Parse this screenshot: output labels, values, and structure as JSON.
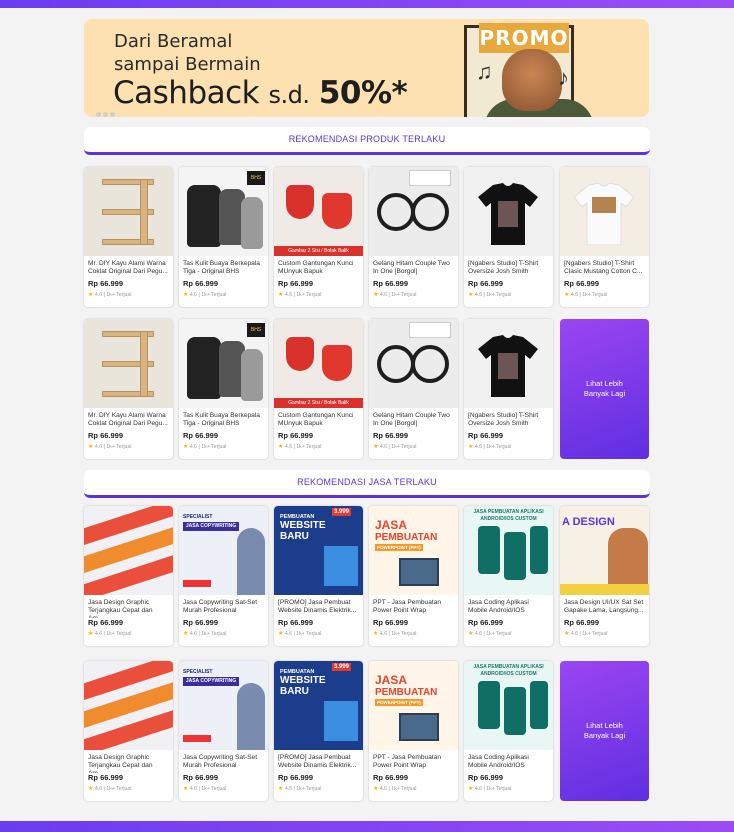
{
  "banner": {
    "line1": "Dari Beramal",
    "line2": "sampai Bermain",
    "cashback": "Cashback",
    "sd": "s.d.",
    "percent": "50%*",
    "promo": "PROMO"
  },
  "sections": {
    "products_title": "REKOMENDASI PRODUK TERLAKU",
    "services_title": "REKOMENDASI JASA TERLAKU"
  },
  "more_label": "Lihat Lebih Banyak Lagi",
  "product_row1": [
    {
      "name": "Mr. DIY Kayu Alami Warna Coklat Original Dari Pegu...",
      "price": "Rp 66.999",
      "rating": "4.6 | 1k+ Terjual"
    },
    {
      "name": "Tas Kulit Buaya Berkepala Tiga - Original BHS",
      "price": "Rp 66.999",
      "rating": "4.6 | 1k+ Terjual"
    },
    {
      "name": "Custom Gantungan Kunci MUnyuk Bapuk",
      "price": "Rp 66.999",
      "rating": "4.6 | 1k+ Terjual"
    },
    {
      "name": "Gelang Hitam Couple Two In One [Borgol]",
      "price": "Rp 66.999",
      "rating": "4.6 | 1k+ Terjual"
    },
    {
      "name": "[Ngabers Studio] T-Shirt Oversize Josh Smith",
      "price": "Rp 66.999",
      "rating": "4.6 | 1k+ Terjual"
    },
    {
      "name": "[Ngabers Studio] T-Shirt Clasic Mustang Cotton C...",
      "price": "Rp 66.999",
      "rating": "4.6 | 1k+ Terjual"
    }
  ],
  "product_row2": [
    {
      "name": "Mr. DIY Kayu Alami Warna Coklat Original Dari Pegu...",
      "price": "Rp 66.999",
      "rating": "4.6 | 1k+ Terjual"
    },
    {
      "name": "Tas Kulit Buaya Berkepala Tiga - Original BHS",
      "price": "Rp 66.999",
      "rating": "4.6 | 1k+ Terjual"
    },
    {
      "name": "Custom Gantungan Kunci MUnyuk Bapuk",
      "price": "Rp 66.999",
      "rating": "4.6 | 1k+ Terjual"
    },
    {
      "name": "Gelang Hitam Couple Two In One [Borgol]",
      "price": "Rp 66.999",
      "rating": "4.6 | 1k+ Terjual"
    },
    {
      "name": "[Ngabers Studio] T-Shirt Oversize Josh Smith",
      "price": "Rp 66.999",
      "rating": "4.6 | 1k+ Terjual"
    }
  ],
  "service_row1": [
    {
      "name": "Jasa Design Graphic Terjangkau Cepat dan Am...",
      "price": "Rp 66.999",
      "rating": "4.6 | 1k+ Terjual"
    },
    {
      "name": "Jasa Copywriting Sat-Set Murah Profesional",
      "price": "Rp 66.999",
      "rating": "4.6 | 1k+ Terjual"
    },
    {
      "name": "[PROMO] Jasa Pembuat Website Dinamis Elektrik...",
      "price": "Rp 66.999",
      "rating": "4.6 | 1k+ Terjual"
    },
    {
      "name": "PPT - Jasa Pembuatan Power Point Wrap",
      "price": "Rp 66.999",
      "rating": "4.6 | 1k+ Terjual"
    },
    {
      "name": "Jasa Coding Aplikasi Mobile Android/IOS",
      "price": "Rp 66.999",
      "rating": "4.6 | 1k+ Terjual"
    },
    {
      "name": "Jasa Design UI/UX Sat Set Gapake Lama, Langsung...",
      "price": "Rp 66.999",
      "rating": "4.6 | 1k+ Terjual"
    }
  ],
  "service_row2": [
    {
      "name": "Jasa Design Graphic Terjangkau Cepat dan Am...",
      "price": "Rp 66.999",
      "rating": "4.6 | 1k+ Terjual"
    },
    {
      "name": "Jasa Copywriting Sat-Set Murah Profesional",
      "price": "Rp 66.999",
      "rating": "4.6 | 1k+ Terjual"
    },
    {
      "name": "[PROMO] Jasa Pembuat Website Dinamis Elektrik...",
      "price": "Rp 66.999",
      "rating": "4.6 | 1k+ Terjual"
    },
    {
      "name": "PPT - Jasa Pembuatan Power Point Wrap",
      "price": "Rp 66.999",
      "rating": "4.6 | 1k+ Terjual"
    },
    {
      "name": "Jasa Coding Aplikasi Mobile Android/IOS",
      "price": "Rp 66.999",
      "rating": "4.6 | 1k+ Terjual"
    }
  ],
  "image_text": {
    "copy_badge": "SPECIALIST",
    "copy_title": "JASA COPYWRITING",
    "web_title1": "PEMBUATAN",
    "web_title2": "WEBSITE",
    "web_title3": "BARU",
    "web_price": "3.999",
    "ppt_title1": "JASA",
    "ppt_title2": "PEMBUATAN",
    "ppt_sub": "POWERPOINT (PPT)",
    "app_title": "JASA PEMBUATAN APLIKASI ANDROID/IOS CUSTOM",
    "ux_title": "A DESIGN",
    "key_label": "Gambar 2 Sisi / Bolak Balik"
  },
  "colors": {
    "accent": "#5b34d6",
    "more_gradient_start": "#9b45f2",
    "more_gradient_end": "#5f2fe0",
    "banner_bg": "#fde1b0",
    "star": "#f6b500"
  }
}
